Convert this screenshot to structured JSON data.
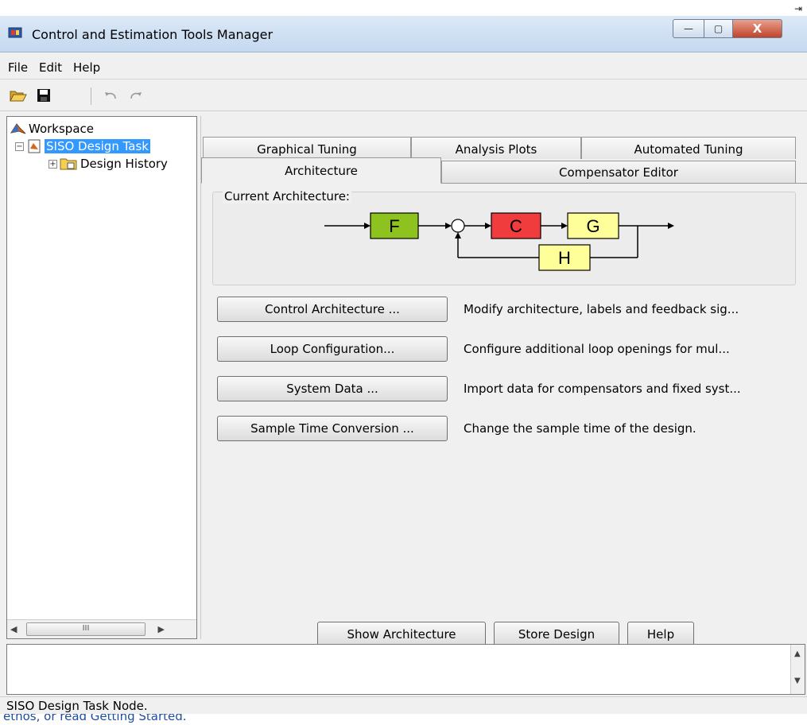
{
  "window": {
    "title": "Control and Estimation Tools Manager",
    "controls": {
      "minimize": "—",
      "maximize": "▢",
      "close": "X"
    }
  },
  "topstrip": {
    "pin_icon": "pin-icon"
  },
  "menubar": {
    "items": [
      "File",
      "Edit",
      "Help"
    ]
  },
  "toolbar": {
    "icons": [
      "open-folder-icon",
      "save-icon",
      "undo-icon",
      "redo-icon"
    ]
  },
  "tree": {
    "items": [
      {
        "label": "Workspace",
        "icon": "matlab-icon",
        "level": 0
      },
      {
        "label": "SISO Design Task",
        "icon": "task-icon",
        "level": 1,
        "selected": true,
        "expander": "−"
      },
      {
        "label": "Design History",
        "icon": "folder-icon",
        "level": 2,
        "expander": "+"
      }
    ],
    "scroll_thumb": "III"
  },
  "tabs": {
    "row1": [
      "Graphical Tuning",
      "Analysis Plots",
      "Automated Tuning"
    ],
    "row2": [
      "Architecture",
      "Compensator Editor"
    ],
    "active": "Architecture"
  },
  "architecture": {
    "label": "Current Architecture:",
    "blocks": {
      "F": {
        "label": "F",
        "color": "#8dc21f"
      },
      "C": {
        "label": "C",
        "color": "#f03c3c"
      },
      "G": {
        "label": "G",
        "color": "#ffff99"
      },
      "H": {
        "label": "H",
        "color": "#ffff99"
      }
    }
  },
  "actions": [
    {
      "button": "Control Architecture ...",
      "desc": "Modify architecture, labels and feedback sig..."
    },
    {
      "button": "Loop Configuration...",
      "desc": "Configure additional loop openings for mul..."
    },
    {
      "button": "System Data ...",
      "desc": "Import data for compensators and fixed syst..."
    },
    {
      "button": "Sample Time Conversion ...",
      "desc": "Change the sample time of the design."
    }
  ],
  "bottom_buttons": [
    "Show Architecture",
    "Store Design",
    "Help"
  ],
  "status": "SISO Design Task Node.",
  "below_text": "ethos, or read Getting Started."
}
